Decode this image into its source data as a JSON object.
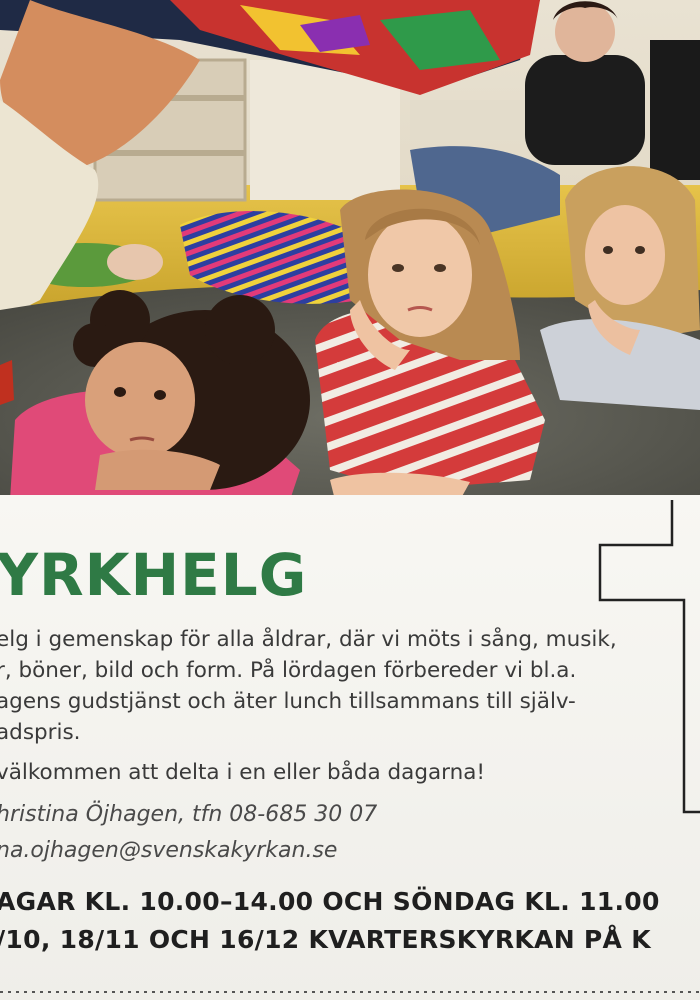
{
  "poster": {
    "title": "YRKHELG",
    "paragraph_lines": [
      "elg i gemenskap för alla åldrar, där vi möts i sång, musik,",
      "r, böner, bild och form. På lördagen förbereder vi bl.a.",
      "agens gudstjänst och äter lunch tillsammans till själv-",
      "adspris."
    ],
    "welcome": "välkommen att delta i en eller båda dagarna!",
    "contact_name_phone": "hristina Öjhagen, tfn 08-685 30 07",
    "contact_email": "na.ojhagen@svenskakyrkan.se",
    "schedule_line1": "AGAR KL. 10.00–14.00 OCH SÖNDAG KL. 11.00",
    "schedule_line2": "/10, 18/11 OCH 16/12 KVARTERSKYRKAN PÅ K"
  },
  "colors": {
    "title_green": "#2f7a45",
    "paper": "#f6f5f1",
    "text_dark": "#1f1f1f",
    "text_body": "#3a3a3a"
  }
}
